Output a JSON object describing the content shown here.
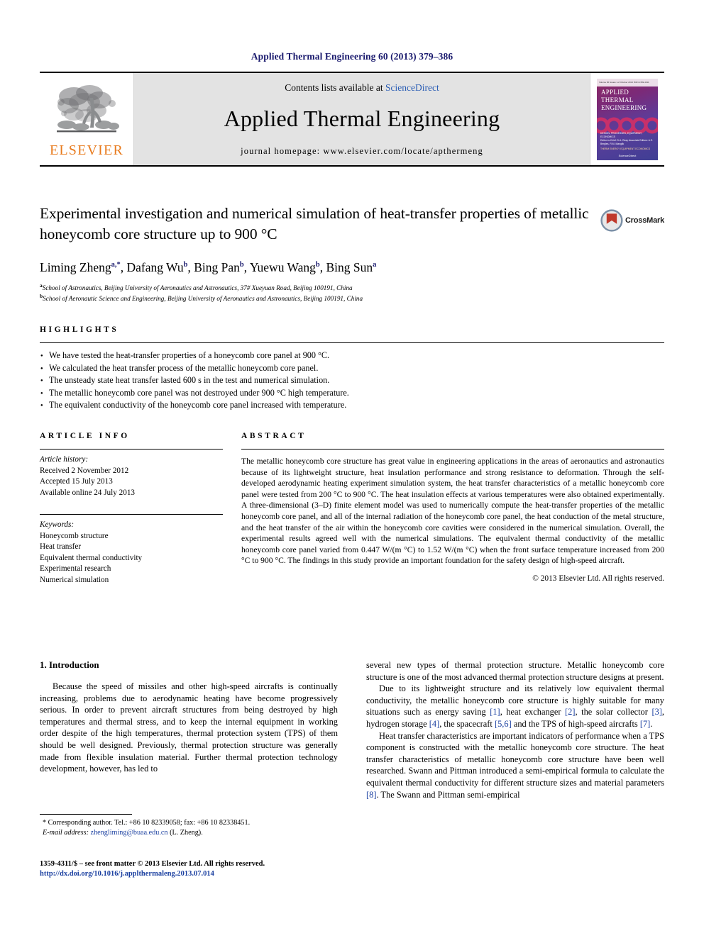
{
  "running_head": "Applied Thermal Engineering 60 (2013) 379–386",
  "masthead": {
    "publisher_name": "ELSEVIER",
    "publisher_logo_icon": "elsevier-tree-icon",
    "contents_prefix": "Contents lists available at ",
    "contents_link": "ScienceDirect",
    "journal_name": "Applied Thermal Engineering",
    "homepage": "journal homepage: www.elsevier.com/locate/apthermeng",
    "cover": {
      "top_bar_text": "Volume 60  Issues 1-2  October 2013    ISSN 1359-4311",
      "title_line1": "APPLIED",
      "title_line2": "THERMAL",
      "title_line3": "ENGINEERING",
      "foot_line1": "DESIGN, PROCESSES, EQUIPMENT, ECONOMICS",
      "foot_line2": "Editor-in-Chief: D.A. Reay    Associate Editors: A.E. Bergles, R.M. Manglik",
      "foot_line3": "THERM    ENERGY    EQUIPMENT    ECONOMICS",
      "foot_line4": "Available online at www.sciencedirect.com",
      "foot_line5": "ScienceDirect"
    }
  },
  "article": {
    "title": "Experimental investigation and numerical simulation of heat-transfer properties of metallic honeycomb core structure up to 900 °C",
    "crossmark_label": "CrossMark",
    "crossmark_icon": "crossmark-icon",
    "authors": [
      {
        "name": "Liming Zheng",
        "sup": "a,*"
      },
      {
        "name": "Dafang Wu",
        "sup": "b"
      },
      {
        "name": "Bing Pan",
        "sup": "b"
      },
      {
        "name": "Yuewu Wang",
        "sup": "b"
      },
      {
        "name": "Bing Sun",
        "sup": "a"
      }
    ],
    "affiliations": [
      {
        "marker": "a",
        "text": "School of Astronautics, Beijing University of Aeronautics and Astronautics, 37# Xueyuan Road, Beijing 100191, China"
      },
      {
        "marker": "b",
        "text": "School of Aeronautic Science and Engineering, Beijing University of Aeronautics and Astronautics, Beijing 100191, China"
      }
    ]
  },
  "highlights": {
    "label": "HIGHLIGHTS",
    "items": [
      "We have tested the heat-transfer properties of a honeycomb core panel at 900 °C.",
      "We calculated the heat transfer process of the metallic honeycomb core panel.",
      "The unsteady state heat transfer lasted 600 s in the test and numerical simulation.",
      "The metallic honeycomb core panel was not destroyed under 900 °C high temperature.",
      "The equivalent conductivity of the honeycomb core panel increased with temperature."
    ]
  },
  "article_info": {
    "label": "ARTICLE INFO",
    "history_title": "Article history:",
    "history": [
      "Received 2 November 2012",
      "Accepted 15 July 2013",
      "Available online 24 July 2013"
    ],
    "keywords_title": "Keywords:",
    "keywords": [
      "Honeycomb structure",
      "Heat transfer",
      "Equivalent thermal conductivity",
      "Experimental research",
      "Numerical simulation"
    ]
  },
  "abstract": {
    "label": "ABSTRACT",
    "text": "The metallic honeycomb core structure has great value in engineering applications in the areas of aeronautics and astronautics because of its lightweight structure, heat insulation performance and strong resistance to deformation. Through the self-developed aerodynamic heating experiment simulation system, the heat transfer characteristics of a metallic honeycomb core panel were tested from 200 °C to 900 °C. The heat insulation effects at various temperatures were also obtained experimentally. A three-dimensional (3–D) finite element model was used to numerically compute the heat-transfer properties of the metallic honeycomb core panel, and all of the internal radiation of the honeycomb core panel, the heat conduction of the metal structure, and the heat transfer of the air within the honeycomb core cavities were considered in the numerical simulation. Overall, the experimental results agreed well with the numerical simulations. The equivalent thermal conductivity of the metallic honeycomb core panel varied from 0.447 W/(m °C) to 1.52 W/(m °C) when the front surface temperature increased from 200 °C to 900 °C. The findings in this study provide an important foundation for the safety design of high-speed aircraft.",
    "copyright": "© 2013 Elsevier Ltd. All rights reserved."
  },
  "body": {
    "section_heading": "1. Introduction",
    "left_paragraphs": [
      "Because the speed of missiles and other high-speed aircrafts is continually increasing, problems due to aerodynamic heating have become progressively serious. In order to prevent aircraft structures from being destroyed by high temperatures and thermal stress, and to keep the internal equipment in working order despite of the high temperatures, thermal protection system (TPS) of them should be well designed. Previously, thermal protection structure was generally made from flexible insulation material. Further thermal protection technology development, however, has led to"
    ],
    "right_paragraph_1": "several new types of thermal protection structure. Metallic honeycomb core structure is one of the most advanced thermal protection structure designs at present.",
    "right_paragraph_2_a": "Due to its lightweight structure and its relatively low equivalent thermal conductivity, the metallic honeycomb core structure is highly suitable for many situations such as energy saving ",
    "right_ref_1": "[1]",
    "right_paragraph_2_b": ", heat exchanger ",
    "right_ref_2": "[2]",
    "right_paragraph_2_c": ", the solar collector ",
    "right_ref_3": "[3]",
    "right_paragraph_2_d": ", hydrogen storage ",
    "right_ref_4": "[4]",
    "right_paragraph_2_e": ", the spacecraft ",
    "right_ref_5": "[5,6]",
    "right_paragraph_2_f": " and the TPS of high-speed aircrafts ",
    "right_ref_6": "[7]",
    "right_paragraph_2_g": ".",
    "right_paragraph_3_a": "Heat transfer characteristics are important indicators of performance when a TPS component is constructed with the metallic honeycomb core structure. The heat transfer characteristics of metallic honeycomb core structure have been well researched. Swann and Pittman introduced a semi-empirical formula to calculate the equivalent thermal conductivity for different structure sizes and material parameters ",
    "right_ref_7": "[8]",
    "right_paragraph_3_b": ". The Swann and Pittman semi-empirical"
  },
  "footnotes": {
    "corresponding": "* Corresponding author. Tel.: +86 10 82339058; fax: +86 10 82338451.",
    "email_label": "E-mail address:",
    "email": "zhengliming@buaa.edu.cn",
    "email_suffix": "(L. Zheng).",
    "imprint_line1": "1359-4311/$ – see front matter © 2013 Elsevier Ltd. All rights reserved.",
    "imprint_line2": "http://dx.doi.org/10.1016/j.applthermaleng.2013.07.014"
  }
}
